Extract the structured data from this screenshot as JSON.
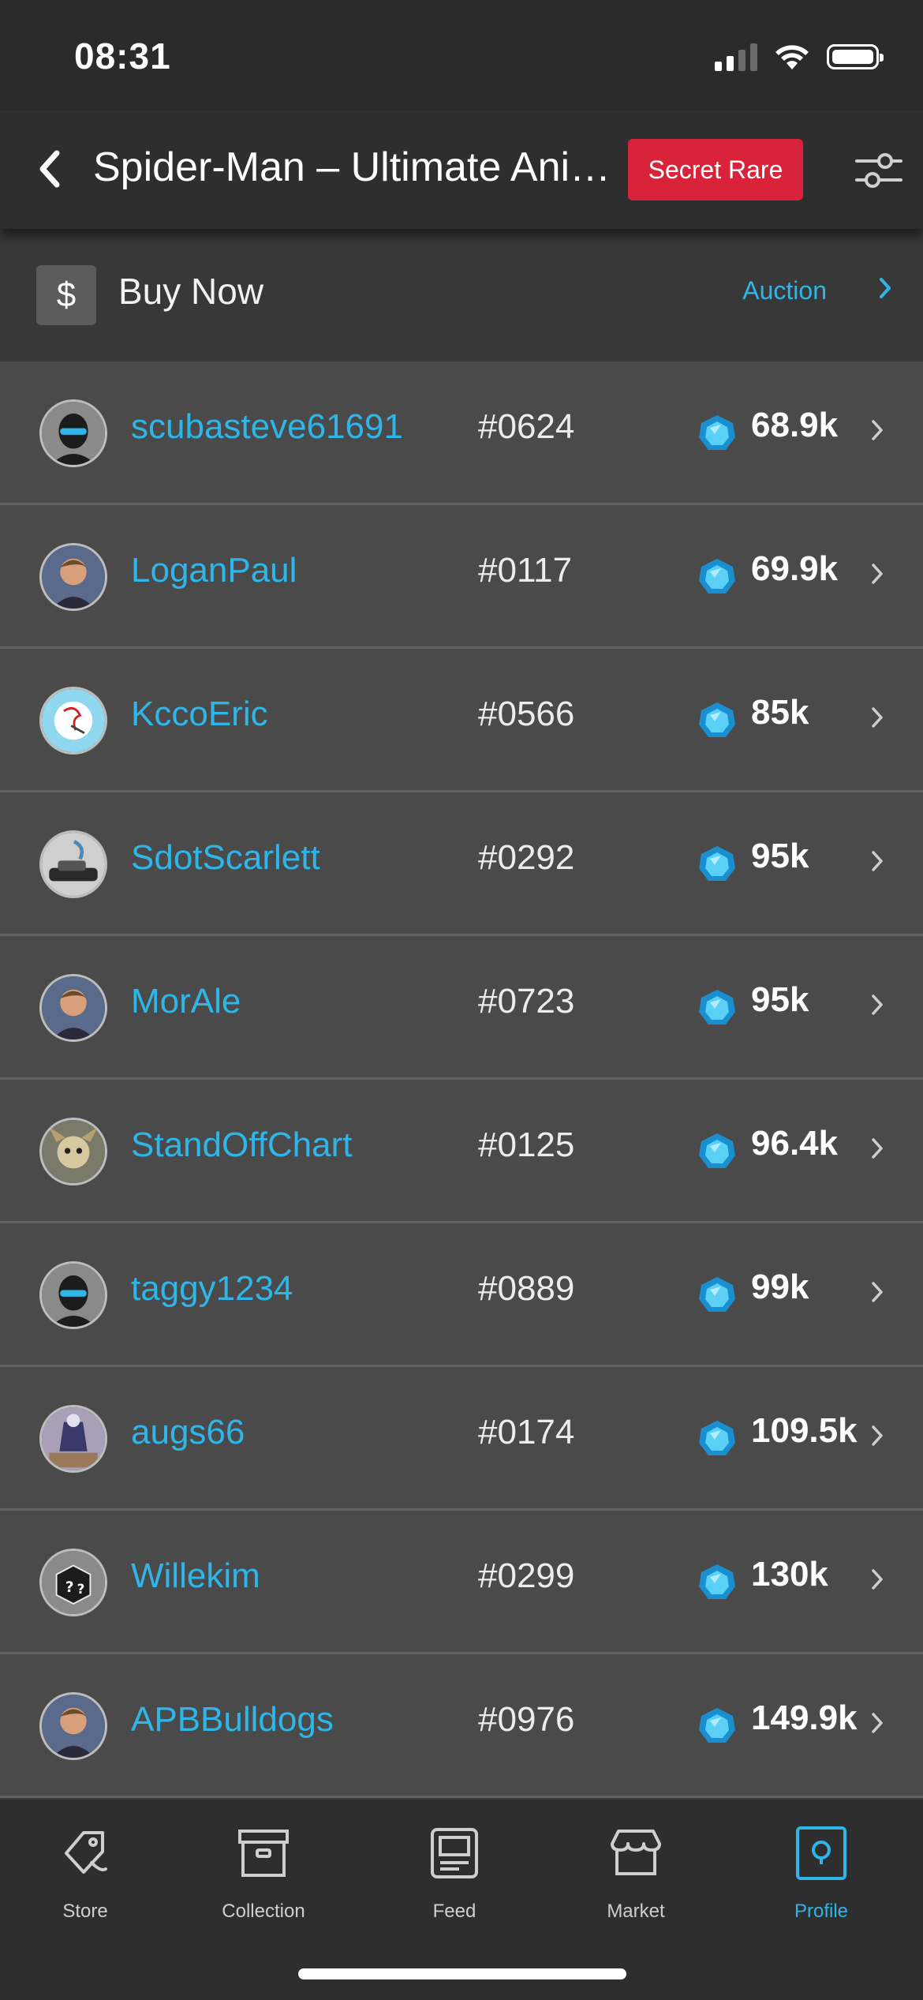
{
  "status_bar": {
    "time": "08:31"
  },
  "header": {
    "title": "Spider-Man – Ultimate Animat...",
    "rarity_badge": "Secret Rare",
    "rarity_color": "#d8233a"
  },
  "buy_bar": {
    "currency_symbol": "$",
    "label": "Buy Now",
    "auction_link": "Auction"
  },
  "accent_color": "#2fb6e8",
  "listings": [
    {
      "user": "scubasteve61691",
      "serial": "#0624",
      "price": "68.9k",
      "avatar": "default-mask-avatar"
    },
    {
      "user": "LoganPaul",
      "serial": "#0117",
      "price": "69.9k",
      "avatar": "photo-avatar"
    },
    {
      "user": "KccoEric",
      "serial": "#0566",
      "price": "85k",
      "avatar": "drawing-avatar"
    },
    {
      "user": "SdotScarlett",
      "serial": "#0292",
      "price": "95k",
      "avatar": "car-avatar"
    },
    {
      "user": "MorAle",
      "serial": "#0723",
      "price": "95k",
      "avatar": "photo-avatar"
    },
    {
      "user": "StandOffChart",
      "serial": "#0125",
      "price": "96.4k",
      "avatar": "creature-avatar"
    },
    {
      "user": "taggy1234",
      "serial": "#0889",
      "price": "99k",
      "avatar": "default-mask-avatar"
    },
    {
      "user": "augs66",
      "serial": "#0174",
      "price": "109.5k",
      "avatar": "figure-avatar"
    },
    {
      "user": "Willekim",
      "serial": "#0299",
      "price": "130k",
      "avatar": "mystery-box-avatar"
    },
    {
      "user": "APBBulldogs",
      "serial": "#0976",
      "price": "149.9k",
      "avatar": "photo-avatar"
    }
  ],
  "tab_bar": {
    "tabs": [
      {
        "label": "Store",
        "icon": "tag-icon"
      },
      {
        "label": "Collection",
        "icon": "archive-box-icon"
      },
      {
        "label": "Feed",
        "icon": "feed-card-icon"
      },
      {
        "label": "Market",
        "icon": "storefront-icon"
      },
      {
        "label": "Profile",
        "icon": "profile-icon"
      }
    ],
    "active": "Profile"
  }
}
